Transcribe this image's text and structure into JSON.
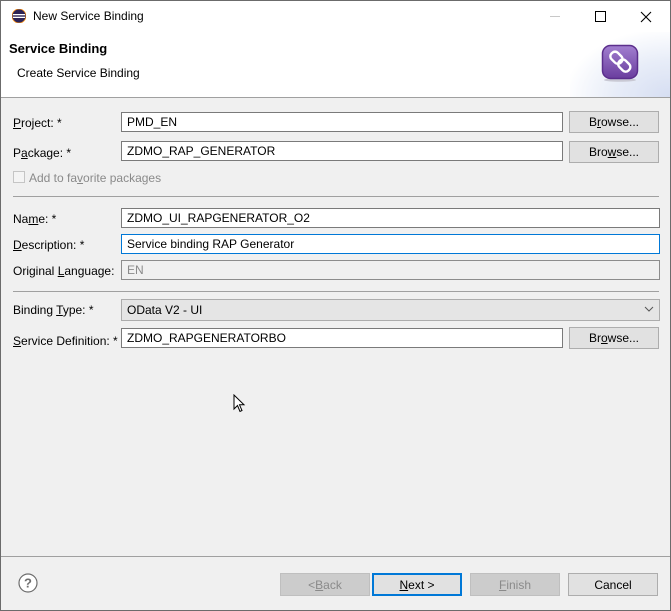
{
  "window": {
    "title": "New Service Binding",
    "controls": {
      "minimize": "minimize",
      "maximize": "maximize",
      "close": "close"
    }
  },
  "header": {
    "title": "Service Binding",
    "description": "Create Service Binding",
    "icon": "service-binding-link-icon",
    "accent_color": "#7b52ab"
  },
  "form": {
    "project": {
      "label_pre": "",
      "label_mn": "P",
      "label_post": "roject: *",
      "value": "PMD_EN",
      "browse": {
        "pre": "B",
        "mn": "r",
        "post": "owse..."
      }
    },
    "package": {
      "label_pre": "P",
      "label_mn": "a",
      "label_post": "ckage: *",
      "value": "ZDMO_RAP_GENERATOR",
      "browse": {
        "pre": "Bro",
        "mn": "w",
        "post": "se..."
      }
    },
    "favorite": {
      "label_pre": "Add to fa",
      "label_mn": "v",
      "label_post": "orite packages",
      "checked": false,
      "enabled": false
    },
    "name": {
      "label_pre": "Na",
      "label_mn": "m",
      "label_post": "e: *",
      "value": "ZDMO_UI_RAPGENERATOR_O2"
    },
    "description": {
      "label_pre": "",
      "label_mn": "D",
      "label_post": "escription: *",
      "value": "Service binding RAP Generator"
    },
    "original_language": {
      "label_pre": "Original ",
      "label_mn": "L",
      "label_post": "anguage:",
      "value": "EN"
    },
    "binding_type": {
      "label_pre": "Binding ",
      "label_mn": "T",
      "label_post": "ype: *",
      "value": "OData V2 - UI"
    },
    "service_definition": {
      "label_pre": "",
      "label_mn": "S",
      "label_post": "ervice Definition: *",
      "value": "ZDMO_RAPGENERATORBO",
      "browse": {
        "pre": "Br",
        "mn": "o",
        "post": "wse..."
      }
    }
  },
  "footer": {
    "help": "help-icon",
    "back": {
      "pre": "< ",
      "mn": "B",
      "post": "ack",
      "enabled": false
    },
    "next": {
      "pre": "",
      "mn": "N",
      "post": "ext >",
      "enabled": true
    },
    "finish": {
      "pre": "",
      "mn": "F",
      "post": "inish",
      "enabled": false
    },
    "cancel": {
      "label": "Cancel",
      "enabled": true
    }
  }
}
